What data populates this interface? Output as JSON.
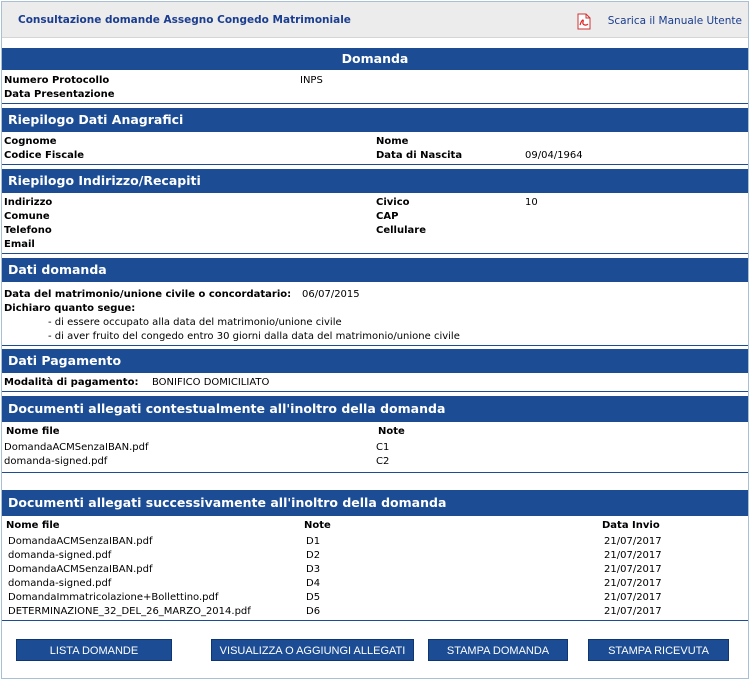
{
  "header": {
    "title": "Consultazione domande Assegno Congedo Matrimoniale",
    "manual_link": "Scarica il Manuale Utente"
  },
  "domanda": {
    "title": "Domanda",
    "numero_label": "Numero Protocollo",
    "numero_value": "INPS",
    "data_label": "Data Presentazione"
  },
  "anagrafici": {
    "title": "Riepilogo Dati Anagrafici",
    "cognome": "Cognome",
    "nome": "Nome",
    "codice_fiscale": "Codice Fiscale",
    "data_nascita_label": "Data di Nascita",
    "data_nascita_value": "09/04/1964"
  },
  "recapiti": {
    "title": "Riepilogo Indirizzo/Recapiti",
    "indirizzo": "Indirizzo",
    "civico_label": "Civico",
    "civico_value": "10",
    "comune": "Comune",
    "cap": "CAP",
    "telefono": "Telefono",
    "cellulare": "Cellulare",
    "email": "Email"
  },
  "dati_domanda": {
    "title": "Dati domanda",
    "matrimonio_label": "Data del matrimonio/unione civile o concordatario:",
    "matrimonio_value": "06/07/2015",
    "dichiaro": "Dichiaro quanto segue:",
    "item1": "- di essere occupato alla data del matrimonio/unione civile",
    "item2": "- di aver fruito del congedo entro 30 giorni dalla data del matrimonio/unione civile"
  },
  "pagamento": {
    "title": "Dati Pagamento",
    "label": "Modalità di pagamento:",
    "value": "BONIFICO DOMICILIATO"
  },
  "allegati_contestuali": {
    "title": "Documenti allegati contestualmente all'inoltro della domanda",
    "col_file": "Nome file",
    "col_note": "Note",
    "rows": [
      {
        "file": "DomandaACMSenzaIBAN.pdf",
        "note": "C1"
      },
      {
        "file": "domanda-signed.pdf",
        "note": "C2"
      }
    ]
  },
  "allegati_successivi": {
    "title": "Documenti allegati successivamente all'inoltro della domanda",
    "col_file": "Nome file",
    "col_note": "Note",
    "col_data": "Data Invio",
    "rows": [
      {
        "file": "DomandaACMSenzaIBAN.pdf",
        "note": "D1",
        "data": "21/07/2017"
      },
      {
        "file": "domanda-signed.pdf",
        "note": "D2",
        "data": "21/07/2017"
      },
      {
        "file": "DomandaACMSenzaIBAN.pdf",
        "note": "D3",
        "data": "21/07/2017"
      },
      {
        "file": "domanda-signed.pdf",
        "note": "D4",
        "data": "21/07/2017"
      },
      {
        "file": "DomandaImmatricolazione+Bollettino.pdf",
        "note": "D5",
        "data": "21/07/2017"
      },
      {
        "file": "DETERMINAZIONE_32_DEL_26_MARZO_2014.pdf",
        "note": "D6",
        "data": "21/07/2017"
      }
    ]
  },
  "buttons": {
    "lista": "LISTA DOMANDE",
    "visualizza": "VISUALIZZA O AGGIUNGI ALLEGATI",
    "stampa_domanda": "STAMPA DOMANDA",
    "stampa_ricevuta": "STAMPA RICEVUTA"
  },
  "colors": {
    "section_bg": "#1c4d94",
    "title_text": "#1a3d8f"
  }
}
